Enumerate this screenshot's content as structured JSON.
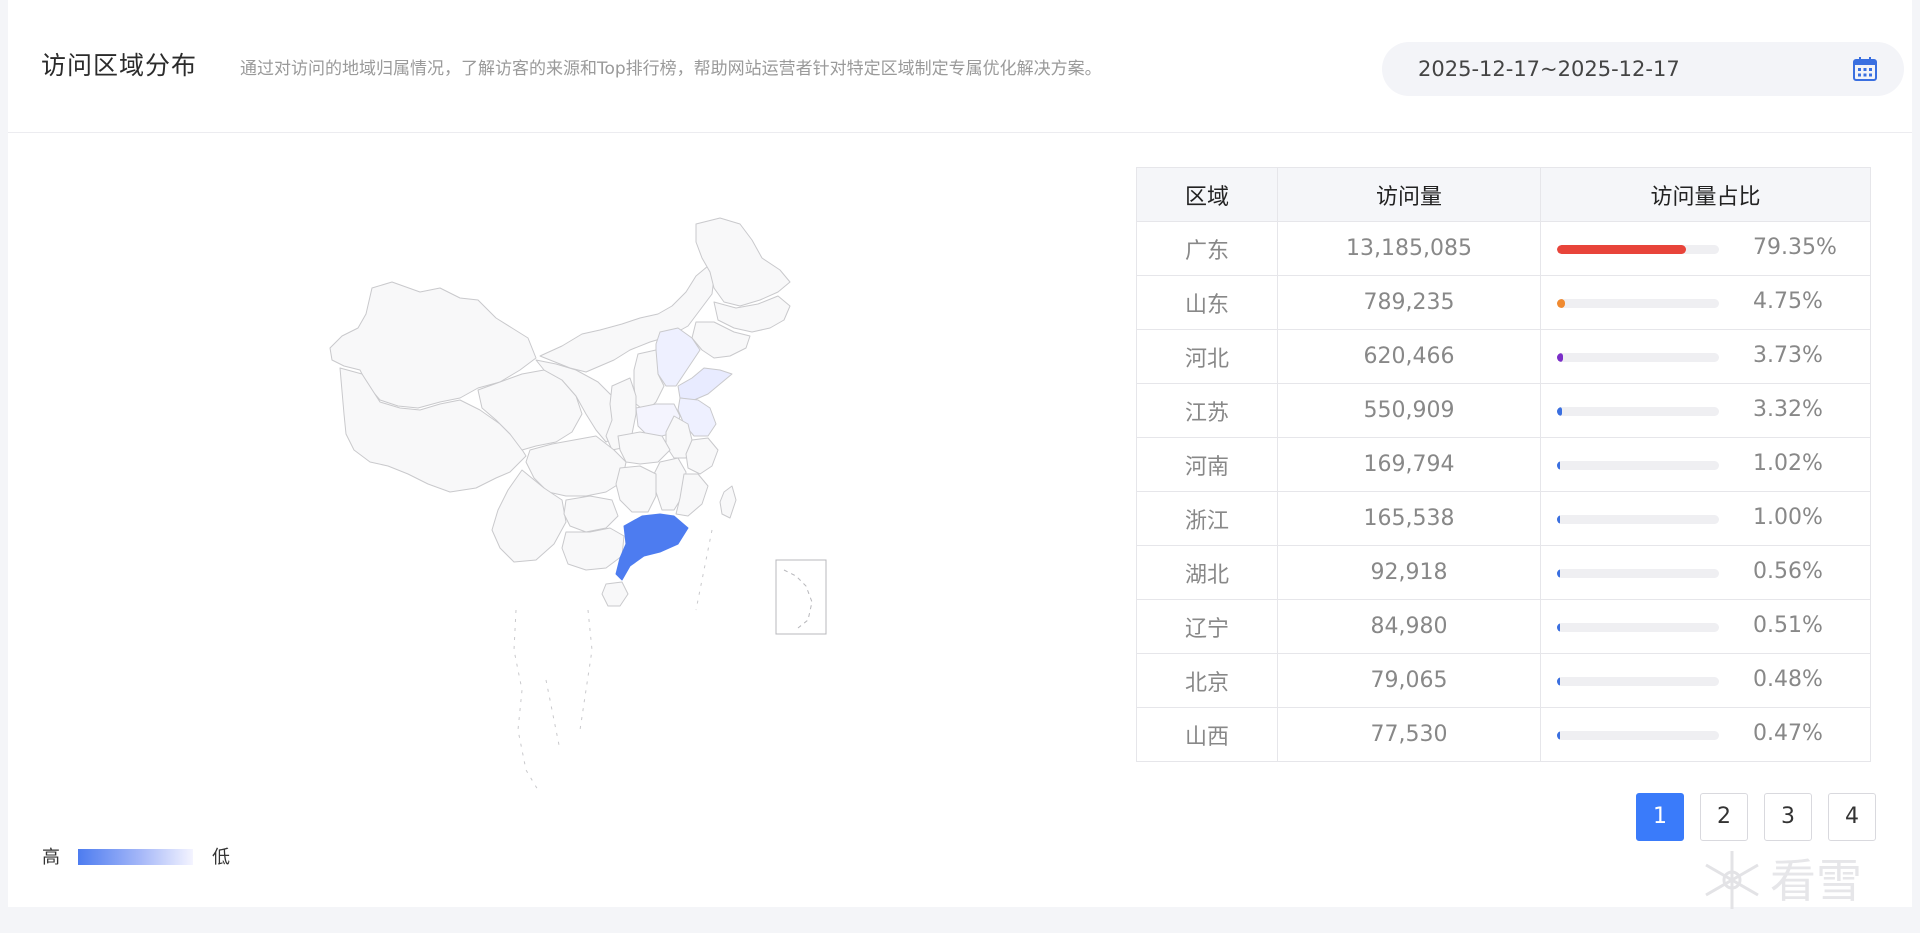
{
  "header": {
    "title": "访问区域分布",
    "description": "通过对访问的地域归属情况，了解访客的来源和Top排行榜，帮助网站运营者针对特定区域制定专属优化解决方案。",
    "date_range": "2025-12-17~2025-12-17",
    "calendar_icon": "calendar-icon"
  },
  "legend": {
    "high": "高",
    "low": "低"
  },
  "table": {
    "headers": {
      "region": "区域",
      "visits": "访问量",
      "ratio": "访问量占比"
    },
    "rows": [
      {
        "region": "广东",
        "visits": "13,185,085",
        "pct": "79.35%",
        "fraction": 0.7935,
        "color": "#e8443a"
      },
      {
        "region": "山东",
        "visits": "789,235",
        "pct": "4.75%",
        "fraction": 0.0475,
        "color": "#f08a30"
      },
      {
        "region": "河北",
        "visits": "620,466",
        "pct": "3.73%",
        "fraction": 0.0373,
        "color": "#7b2ec8"
      },
      {
        "region": "江苏",
        "visits": "550,909",
        "pct": "3.32%",
        "fraction": 0.0332,
        "color": "#3a6fe0"
      },
      {
        "region": "河南",
        "visits": "169,794",
        "pct": "1.02%",
        "fraction": 0.0102,
        "color": "#3a6fe0"
      },
      {
        "region": "浙江",
        "visits": "165,538",
        "pct": "1.00%",
        "fraction": 0.01,
        "color": "#3a6fe0"
      },
      {
        "region": "湖北",
        "visits": "92,918",
        "pct": "0.56%",
        "fraction": 0.0056,
        "color": "#3a6fe0"
      },
      {
        "region": "辽宁",
        "visits": "84,980",
        "pct": "0.51%",
        "fraction": 0.0051,
        "color": "#3a6fe0"
      },
      {
        "region": "北京",
        "visits": "79,065",
        "pct": "0.48%",
        "fraction": 0.0048,
        "color": "#3a6fe0"
      },
      {
        "region": "山西",
        "visits": "77,530",
        "pct": "0.47%",
        "fraction": 0.0047,
        "color": "#3a6fe0"
      }
    ]
  },
  "pagination": {
    "pages": [
      "1",
      "2",
      "3",
      "4"
    ],
    "active": "1"
  },
  "watermark": {
    "text": "看雪",
    "icon": "snowflake-icon"
  },
  "colors": {
    "accent": "#3a7bfa",
    "map_highlight": "#4d7cf0",
    "map_fill": "#f8f8f9"
  }
}
